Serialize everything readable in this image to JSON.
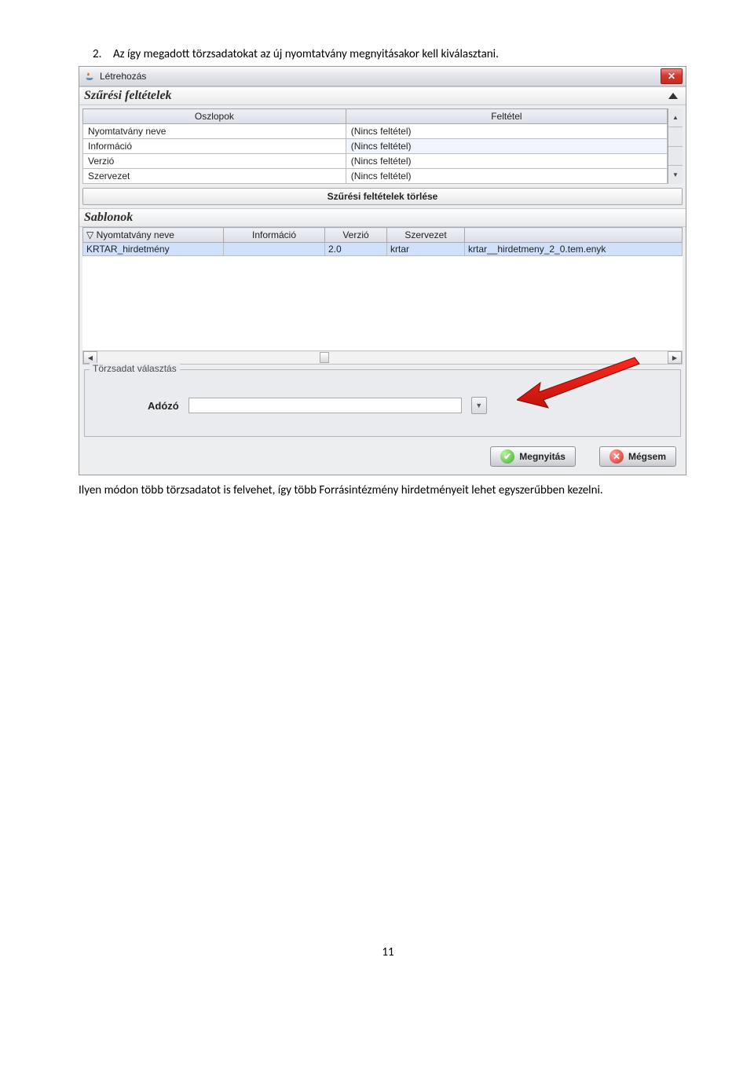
{
  "intro": {
    "number": "2.",
    "text": "Az így megadott törzsadatokat az új nyomtatvány megnyitásakor kell kiválasztani."
  },
  "window": {
    "title": "Létrehozás",
    "close": "✕",
    "filter_section": "Szűrési feltételek",
    "filter_columns": [
      "Oszlopok",
      "Feltétel"
    ],
    "filter_rows": [
      {
        "col": "Nyomtatvány neve",
        "cond": "(Nincs feltétel)"
      },
      {
        "col": "Információ",
        "cond": "(Nincs feltétel)"
      },
      {
        "col": "Verzió",
        "cond": "(Nincs feltétel)"
      },
      {
        "col": "Szervezet",
        "cond": "(Nincs feltétel)"
      }
    ],
    "clear_filter": "Szűrési feltételek törlése",
    "templates_section": "Sablonok",
    "tmpl_headers": [
      "▽ Nyomtatvány neve",
      "Információ",
      "Verzió",
      "Szervezet",
      ""
    ],
    "tmpl_row": {
      "name": "KRTAR_hirdetmény",
      "info": "",
      "ver": "2.0",
      "org": "krtar",
      "file": "krtar__hirdetmeny_2_0.tem.enyk"
    },
    "group_legend": "Törzsadat választás",
    "adozo_label": "Adózó",
    "open_btn": "Megnyitás",
    "cancel_btn": "Mégsem"
  },
  "outro": "Ilyen módon több törzsadatot is felvehet, így több Forrásintézmény hirdetményeit lehet egyszerűbben kezelni.",
  "page_number": "11"
}
